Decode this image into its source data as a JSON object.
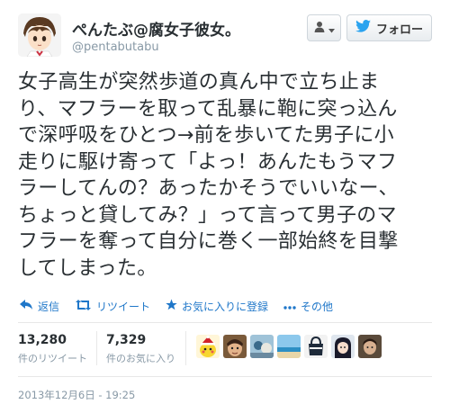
{
  "user": {
    "display_name": "ぺんたぶ@腐女子彼女。",
    "handle": "@pentabutabu"
  },
  "buttons": {
    "follow_label": "フォロー",
    "user_menu_icon": "user-dropdown-icon",
    "follow_icon": "twitter-bird-icon"
  },
  "tweet": {
    "lines": [
      "女子高生が突然歩道の真ん中で立ち止ま",
      "り、マフラーを取って乱暴に鞄に突っ込ん",
      "で深呼吸をひとつ→前を歩いてた男子に小",
      "走りに駆け寄って「よっ！あんたもうマフ",
      "ラーしてんの？あったかそうでいいなー、",
      "ちょっと貸してみ？」って言って男子のマ",
      "フラーを奪って自分に巻く一部始終を目撃",
      "してしまった。"
    ]
  },
  "actions": [
    {
      "label": "返信",
      "icon": "reply-icon"
    },
    {
      "label": "リツイート",
      "icon": "retweet-icon"
    },
    {
      "label": "お気に入りに登録",
      "icon": "star-icon"
    },
    {
      "label": "その他",
      "icon": "more-icon"
    }
  ],
  "stats": {
    "retweets": {
      "count": "13,280",
      "label": "件のリツイート"
    },
    "favorites": {
      "count": "7,329",
      "label": "件のお気に入り"
    }
  },
  "timestamp": "2013年12月6日 - 19:25",
  "colors": {
    "link": "#1f77c9",
    "muted": "#8899a6",
    "text": "#292f33",
    "twitter_blue": "#2aa3ef"
  }
}
